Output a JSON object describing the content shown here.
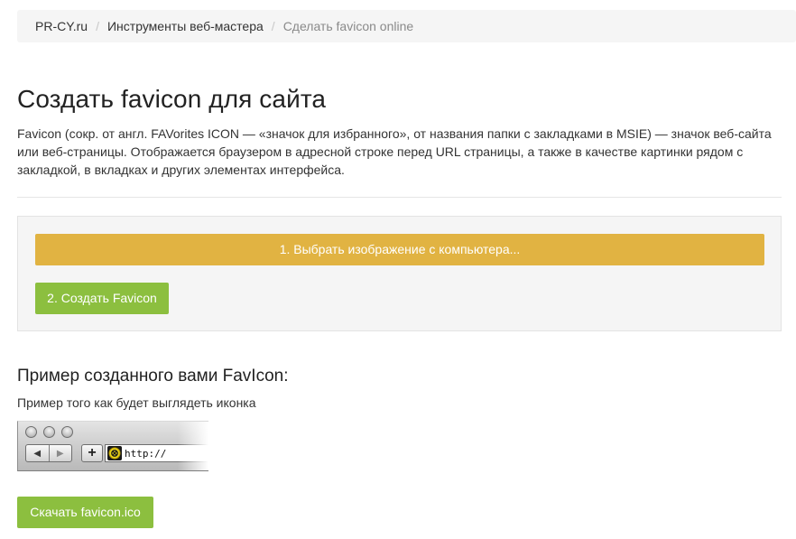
{
  "breadcrumb": {
    "items": [
      "PR-CY.ru",
      "Инструменты веб-мастера"
    ],
    "current": "Сделать favicon online",
    "separator": "/"
  },
  "page": {
    "title": "Создать favicon для сайта",
    "intro": "Favicon (сокр. от англ. FAVorites ICON — «значок для избранного», от названия папки с закладками в MSIE) — значок веб-сайта или веб-страницы. Отображается браузером в адресной строке перед URL страницы, а также в качестве картинки рядом с закладкой, в вкладках и других элементах интерфейса."
  },
  "upload": {
    "choose_label": "1. Выбрать изображение с компьютера...",
    "create_label": "2. Создать Favicon"
  },
  "example": {
    "heading": "Пример созданного вами FavIcon:",
    "subtitle": "Пример того как будет выглядеть иконка",
    "browser": {
      "back_glyph": "◀",
      "forward_glyph": "▶",
      "plus_glyph": "+",
      "url": "http://",
      "favicon_icon": "favicon-preview-icon"
    }
  },
  "download": {
    "label": "Скачать favicon.ico"
  },
  "colors": {
    "orange_button": "#e1b342",
    "green_button": "#8cbf3f",
    "panel_bg": "#f5f5f5"
  }
}
